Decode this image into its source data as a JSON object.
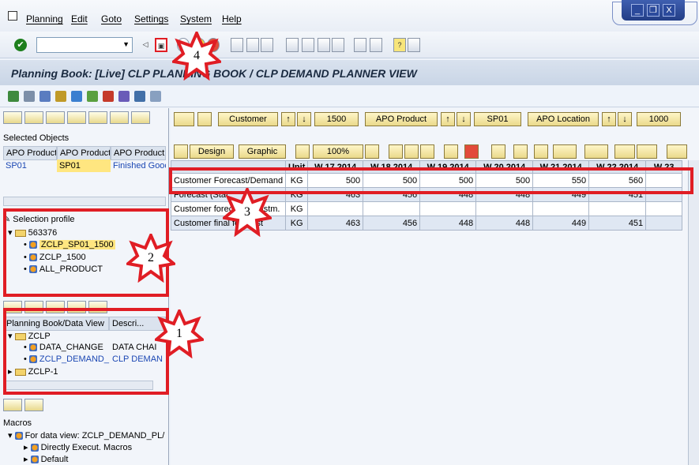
{
  "menu": [
    "Planning",
    "Edit",
    "Goto",
    "Settings",
    "System",
    "Help"
  ],
  "window_controls": [
    "_",
    "❐",
    "X"
  ],
  "title": "Planning Book: [Live] CLP PLANNING BOOK / CLP DEMAND PLANNER VIEW",
  "selected_objects": {
    "heading": "Selected Objects",
    "columns": [
      "APO Product",
      "APO Product",
      "APO Product"
    ],
    "row": [
      "SP01",
      "SP01",
      "Finished Gooc"
    ]
  },
  "selection_profile": {
    "heading": "Selection profile",
    "root": "563376",
    "items": [
      "ZCLP_SP01_1500",
      "ZCLP_1500",
      "ALL_PRODUCT"
    ]
  },
  "planning_book_tree": {
    "columns": [
      "Planning Book/Data View",
      "Descri..."
    ],
    "books": [
      {
        "name": "ZCLP",
        "views": [
          {
            "name": "DATA_CHANGE",
            "desc": "DATA CHAI"
          },
          {
            "name": "ZCLP_DEMAND_",
            "desc": "CLP DEMAN"
          }
        ]
      },
      {
        "name": "ZCLP-1",
        "views": []
      }
    ]
  },
  "macros": {
    "heading": "Macros",
    "items": [
      "For data view: ZCLP_DEMAND_PL/",
      "Directly Execut. Macros",
      "Default"
    ]
  },
  "navigation": {
    "customer_label": "Customer",
    "customer_value": "1500",
    "product_label": "APO Product",
    "product_value": "SP01",
    "location_label": "APO Location",
    "location_value": "1000"
  },
  "grid_toolbar": {
    "design": "Design",
    "graphic": "Graphic",
    "zoom": "100%"
  },
  "grid": {
    "unit_header": "Unit",
    "weeks": [
      "W 17.2014",
      "W 18.2014",
      "W 19.2014",
      "W 20.2014",
      "W 21.2014",
      "W 22.2014",
      "W 23"
    ],
    "rows": [
      {
        "label": "Customer Forecast/Demand",
        "unit": "KG",
        "values": [
          "500",
          "500",
          "500",
          "500",
          "550",
          "560",
          ""
        ]
      },
      {
        "label": "Forecast (Stat",
        "unit": "KG",
        "values": [
          "463",
          "456",
          "448",
          "448",
          "449",
          "451",
          ""
        ]
      },
      {
        "label": "Customer forecast adjustm.",
        "unit": "KG",
        "values": [
          "",
          "",
          "",
          "",
          "",
          "",
          ""
        ]
      },
      {
        "label": "Customer final forecast",
        "unit": "KG",
        "values": [
          "463",
          "456",
          "448",
          "448",
          "449",
          "451",
          ""
        ]
      }
    ]
  },
  "annotations": [
    "1",
    "2",
    "3",
    "4"
  ]
}
